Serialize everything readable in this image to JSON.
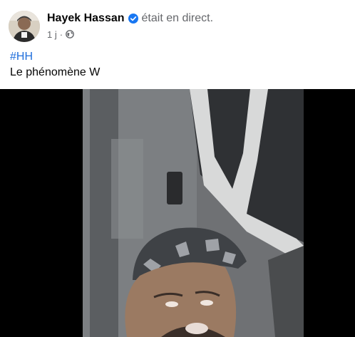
{
  "post": {
    "author": "Hayek Hassan",
    "status": "était en direct.",
    "time": "1 j",
    "separator": "·",
    "privacy_icon": "globe-icon",
    "verified_icon": "verified-badge-icon",
    "hashtag": "#HH",
    "caption": "Le phénomène W"
  },
  "colors": {
    "hashtag": "#216fdb",
    "secondary_text": "#65676b",
    "verified": "#1877f2"
  }
}
